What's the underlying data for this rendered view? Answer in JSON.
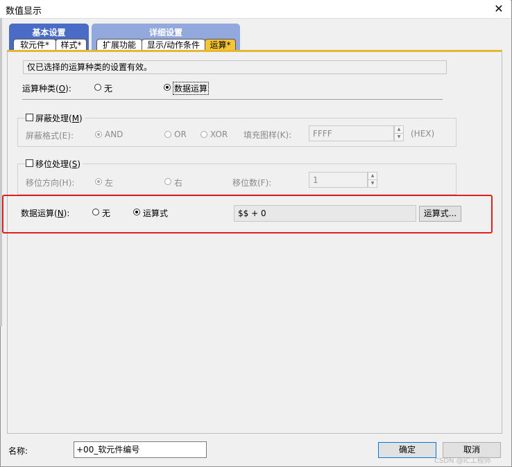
{
  "window": {
    "title": "数值显示",
    "close_glyph": "✕"
  },
  "tab_groups": [
    {
      "label": "基本设置",
      "color": "#4a6bc6"
    },
    {
      "label": "详细设置",
      "color": "#93a9de"
    }
  ],
  "tabs": [
    {
      "label": "软元件*",
      "active": false
    },
    {
      "label": "样式*",
      "active": false
    },
    {
      "label": "扩展功能",
      "active": false
    },
    {
      "label": "显示/动作条件",
      "active": false
    },
    {
      "label": "运算*",
      "active": true
    }
  ],
  "info_text": "仅已选择的运算种类的设置有效。",
  "op_type": {
    "label": "运算种类(",
    "key": "O",
    "suffix": "):",
    "options": [
      "无",
      "数据运算"
    ],
    "selected": 1
  },
  "mask": {
    "checkbox_label": "屏蔽处理(",
    "key": "M",
    "suffix": ")",
    "format_label": "屏蔽格式(E):",
    "format_options": [
      "AND",
      "OR",
      "XOR"
    ],
    "fill_label": "填充图样(K):",
    "fill_value": "FFFF",
    "fill_unit": "(HEX)"
  },
  "shift": {
    "checkbox_label": "移位处理(",
    "key": "S",
    "suffix": ")",
    "dir_label": "移位方向(H):",
    "dir_options": [
      "左",
      "右"
    ],
    "count_label": "移位数(F):",
    "count_value": "1"
  },
  "data_op": {
    "label": "数据运算(",
    "key": "N",
    "suffix": "):",
    "options": [
      "无",
      "运算式"
    ],
    "selected": 1,
    "expression": "$$ + 0",
    "expr_button": "运算式..."
  },
  "footer": {
    "name_label": "名称:",
    "name_value": "+00_软元件编号",
    "ok": "确定",
    "cancel": "取消"
  },
  "watermark": "CSDN @IC工程师",
  "colors": {
    "active_tab": "#f5c535",
    "highlight_border": "#e02020",
    "panel_top": "#e3b731"
  }
}
